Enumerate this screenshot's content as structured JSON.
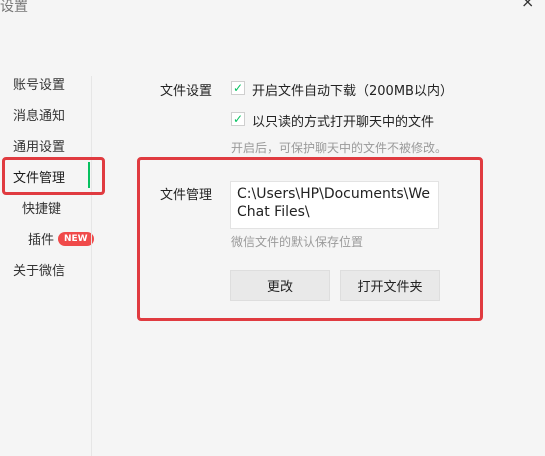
{
  "window": {
    "title": "设置",
    "close_glyph": "×"
  },
  "sidebar": {
    "items": [
      {
        "label": "账号设置"
      },
      {
        "label": "消息通知"
      },
      {
        "label": "通用设置"
      },
      {
        "label": "文件管理",
        "active": true
      },
      {
        "label": "快捷键"
      },
      {
        "label": "插件",
        "badge": "NEW"
      },
      {
        "label": "关于微信"
      }
    ]
  },
  "file_settings": {
    "label": "文件设置",
    "auto_download": {
      "checked": true,
      "label": "开启文件自动下载（200MB以内）"
    },
    "readonly_open": {
      "checked": true,
      "label": "以只读的方式打开聊天中的文件"
    },
    "readonly_hint": "开启后，可保护聊天中的文件不被修改。"
  },
  "file_manage": {
    "label": "文件管理",
    "path": "C:\\Users\\HP\\Documents\\WeChat Files\\",
    "path_hint": "微信文件的默认保存位置",
    "change_button": "更改",
    "open_folder_button": "打开文件夹"
  },
  "icons": {
    "check": "check-icon",
    "close": "close-icon"
  },
  "colors": {
    "accent_green": "#07c160",
    "annotation_red": "#e03b40",
    "badge_red": "#f04a4a"
  }
}
